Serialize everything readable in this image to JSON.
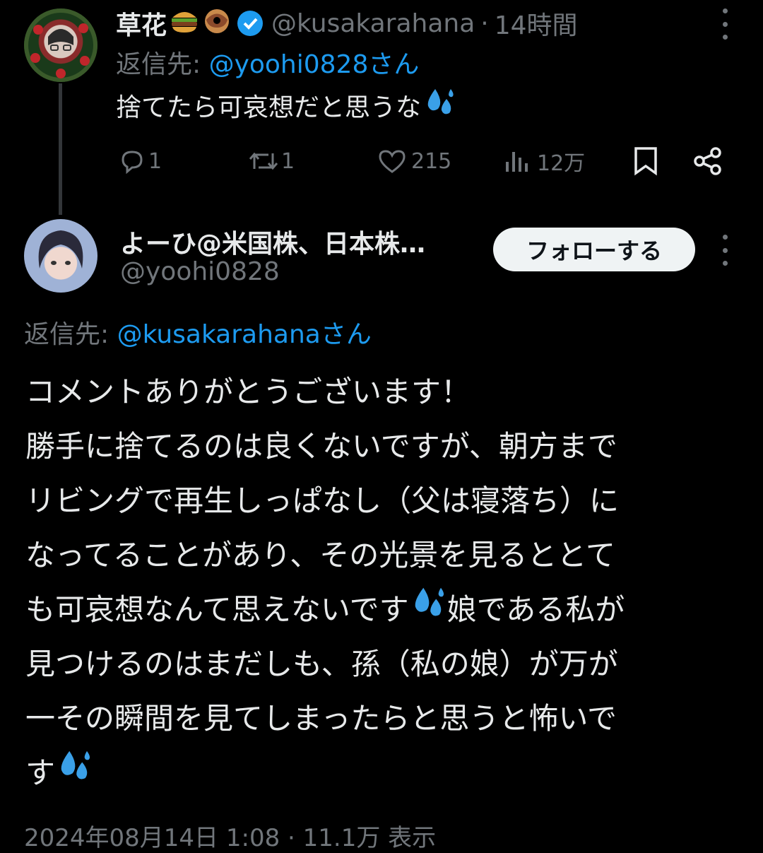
{
  "tweet1": {
    "display_name": "草花",
    "handle": "@kusakarahana",
    "separator": "·",
    "time": "14時間",
    "reply_prefix": "返信先: ",
    "reply_to": "@yoohi0828さん",
    "text": "捨てたら可哀想だと思うな",
    "stats": {
      "replies": "1",
      "retweets": "1",
      "likes": "215",
      "views": "12万"
    }
  },
  "tweet2": {
    "display_name": "よーひ@米国株、日本株…",
    "handle": "@yoohi0828",
    "follow_label": "フォローする",
    "reply_prefix": "返信先: ",
    "reply_to": "@kusakarahanaさん",
    "lines": [
      "コメントありがとうございます！",
      "勝手に捨てるのは良くないですが、朝方まで",
      "リビングで再生しっぱなし（父は寝落ち）に",
      "なってることがあり、その光景を見るととて",
      "も可哀想なんて思えないです",
      "娘である私が",
      "見つけるのはまだしも、孫（私の娘）が万が",
      "一その瞬間を見てしまったらと思うと怖いで",
      "す"
    ],
    "footer": "2024年08月14日 1:08 · 11.1万 表示"
  },
  "colors": {
    "background": "#000000",
    "text": "#e7e9ea",
    "muted": "#71767b",
    "link": "#1d9bf0",
    "verified": "#1d9bf0"
  },
  "icons": [
    "reply-icon",
    "retweet-icon",
    "like-icon",
    "views-icon",
    "bookmark-icon",
    "share-icon",
    "more-icon",
    "verified-badge-icon",
    "sweat-droplets-emoji",
    "burger-emoji",
    "donut-emoji"
  ]
}
